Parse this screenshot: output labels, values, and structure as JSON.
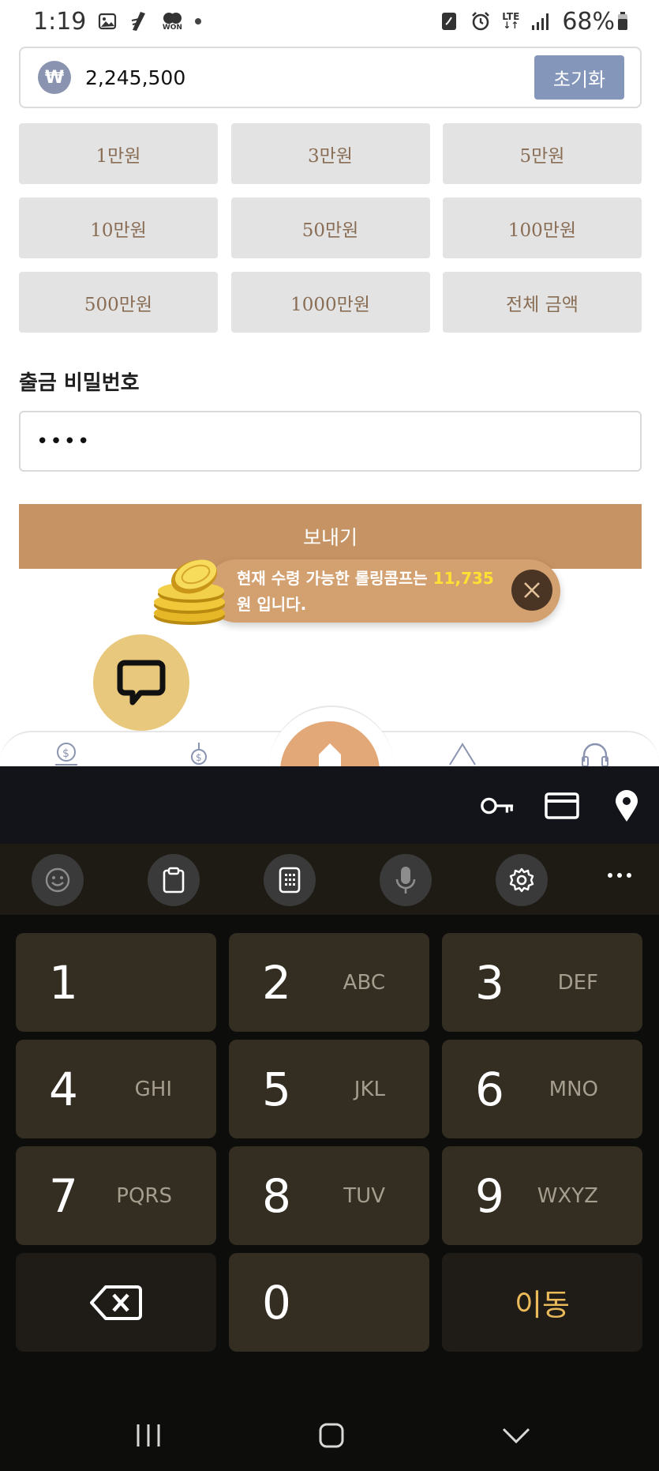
{
  "status_bar": {
    "time": "1:19",
    "won_label": "WON",
    "lte_label": "LTE",
    "battery": "68%"
  },
  "amount": {
    "currency_symbol": "₩",
    "value": "2,245,500",
    "reset_label": "초기화"
  },
  "quick_amounts": [
    "1만원",
    "3만원",
    "5만원",
    "10만원",
    "50만원",
    "100만원",
    "500만원",
    "1000만원",
    "전체 금액"
  ],
  "password": {
    "label": "출금 비밀번호",
    "value": "••••"
  },
  "send_label": "보내기",
  "toast": {
    "text_before": "현재 수령 가능한 롤링콤프는 ",
    "amount": "11,735",
    "text_after": " 원 입니다.",
    "highlight_color": "#ffe033"
  },
  "keyboard": {
    "keys": [
      {
        "num": "1",
        "letters": ""
      },
      {
        "num": "2",
        "letters": "ABC"
      },
      {
        "num": "3",
        "letters": "DEF"
      },
      {
        "num": "4",
        "letters": "GHI"
      },
      {
        "num": "5",
        "letters": "JKL"
      },
      {
        "num": "6",
        "letters": "MNO"
      },
      {
        "num": "7",
        "letters": "PQRS"
      },
      {
        "num": "8",
        "letters": "TUV"
      },
      {
        "num": "9",
        "letters": "WXYZ"
      },
      {
        "num": "0",
        "letters": ""
      }
    ],
    "go_label": "이동"
  },
  "colors": {
    "accent": "#c69464",
    "reset_button": "#8497bb",
    "quick_button_bg": "#e3e3e3",
    "quick_button_text": "#8a6d55",
    "keyboard_key": "#332d22",
    "go_text": "#e9b95a"
  }
}
